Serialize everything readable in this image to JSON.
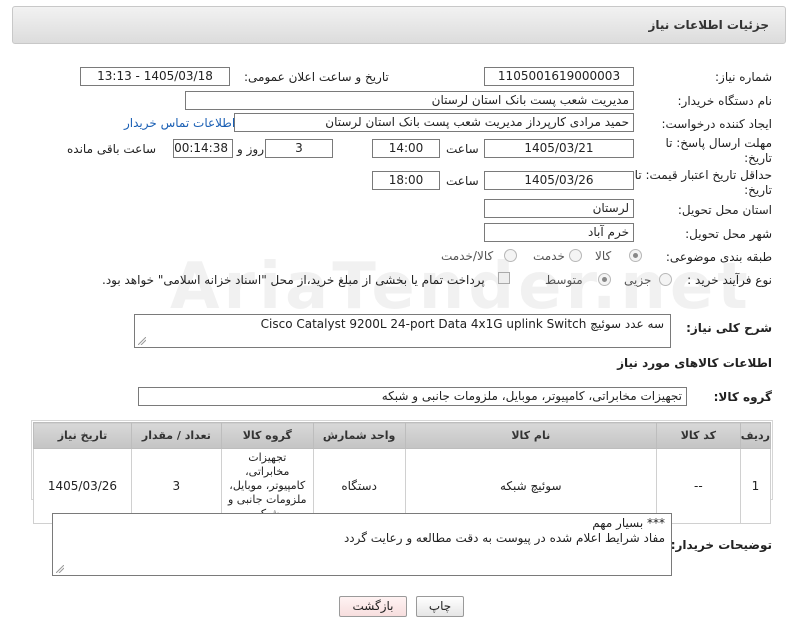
{
  "header": {
    "title": "جزئیات اطلاعات نیاز"
  },
  "fields": {
    "need_number_label": "شماره نیاز:",
    "need_number": "1105001619000003",
    "announce_label": "تاریخ و ساعت اعلان عمومی:",
    "announce_value": "1405/03/18 - 13:13",
    "buyer_org_label": "نام دستگاه خریدار:",
    "buyer_org": "مدیریت شعب پست بانک استان لرستان",
    "creator_label": "ایجاد کننده درخواست:",
    "creator": "حمید مرادی کارپرداز مدیریت شعب پست بانک استان لرستان",
    "contact_link": "اطلاعات تماس خریدار",
    "reply_deadline_label": "مهلت ارسال پاسخ: تا تاریخ:",
    "reply_date": "1405/03/21",
    "time_label": "ساعت",
    "reply_time": "14:00",
    "days_value": "3",
    "days_label": "روز و",
    "remaining_time": "00:14:38",
    "remaining_label": "ساعت باقی مانده",
    "price_validity_label": "حداقل تاریخ اعتبار قیمت: تا تاریخ:",
    "price_date": "1405/03/26",
    "price_time": "18:00",
    "province_label": "استان محل تحویل:",
    "province": "لرستان",
    "city_label": "شهر محل تحویل:",
    "city": "خرم آباد",
    "category_label": "طبقه بندی موضوعی:",
    "category_options": [
      "کالا",
      "خدمت",
      "کالا/خدمت"
    ],
    "process_label": "نوع فرآیند خرید :",
    "process_options": [
      "جزیی",
      "متوسط"
    ],
    "payment_note": "پرداخت تمام یا بخشی از مبلغ خرید،از محل \"اسناد خزانه اسلامی\" خواهد بود."
  },
  "description": {
    "label": "شرح کلی نیاز:",
    "text": "سه عدد سوئیچ   Cisco Catalyst 9200L 24-port Data 4x1G uplink Switch"
  },
  "goods": {
    "section_title": "اطلاعات کالاهای مورد نیاز",
    "group_label": "گروه کالا:",
    "group_value": "تجهیزات مخابراتی، کامپیوتر، موبایل، ملزومات جانبی و شبکه",
    "columns": [
      "ردیف",
      "کد کالا",
      "نام کالا",
      "واحد شمارش",
      "گروه کالا",
      "تعداد / مقدار",
      "تاریخ نیاز"
    ],
    "rows": [
      {
        "row": "1",
        "code": "--",
        "name": "سوئیچ شبکه",
        "unit": "دستگاه",
        "group": "تجهیزات مخابراتی، کامپیوتر، موبایل، ملزومات جانبی و شبکه",
        "qty": "3",
        "date": "1405/03/26"
      }
    ]
  },
  "buyer_notes": {
    "label": "توضیحات خریدار:",
    "line1": "*** بسیار مهم",
    "line2": "مفاد شرایط اعلام شده در پیوست به دقت مطالعه و رعایت گردد"
  },
  "buttons": {
    "print": "چاپ",
    "back": "بازگشت"
  },
  "watermark": "AriaTender.net"
}
